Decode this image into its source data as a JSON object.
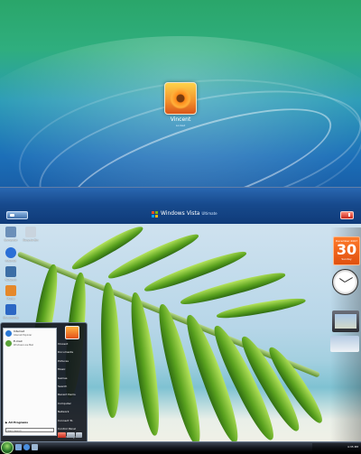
{
  "login": {
    "username": "Vincent",
    "status": "Locked",
    "brand": "Windows Vista",
    "edition": "Ultimate"
  },
  "desktop": {
    "icons": [
      {
        "label": "Computer",
        "color": "#6b8fb8"
      },
      {
        "label": "Recycle Bin",
        "color": "#c9d4de"
      },
      {
        "label": "Internet",
        "color": "#2a6fd6"
      },
      {
        "label": "Network",
        "color": "#3c6ea5"
      },
      {
        "label": "Media",
        "color": "#e5882b"
      },
      {
        "label": "Documents",
        "color": "#2c67c4"
      }
    ]
  },
  "gadgets": {
    "calendar": {
      "month": "December 2007",
      "day": "30",
      "weekday": "Sunday"
    },
    "clock": {
      "hour": 10,
      "minute": 10
    }
  },
  "start_menu": {
    "pinned": [
      {
        "title": "Internet",
        "subtitle": "Internet Explorer",
        "color": "#2a78d6"
      },
      {
        "title": "E-mail",
        "subtitle": "Windows Live Mail",
        "color": "#5aa33a"
      }
    ],
    "all_programs": "All Programs",
    "search_placeholder": "Start Search",
    "right_items": [
      "Vincent",
      "Documents",
      "Pictures",
      "Music",
      "Games",
      "Search",
      "Recent Items",
      "Computer",
      "Network",
      "Connect To",
      "Control Panel",
      "Default Programs",
      "Help and Support"
    ]
  },
  "taskbar": {
    "time": "4:35 PM"
  },
  "colors": {
    "accent": "#1c6fb8",
    "calendar": "#ef6a1e",
    "start_orb": "#3b8f3a"
  }
}
